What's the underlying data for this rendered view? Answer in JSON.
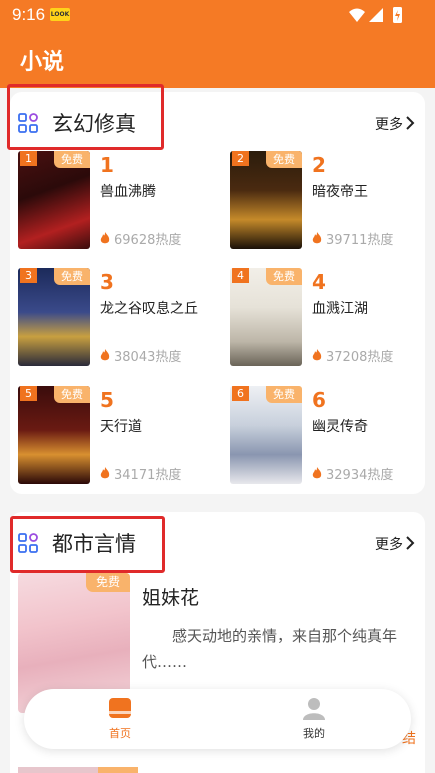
{
  "status": {
    "time": "9:16",
    "badge": "LOOK"
  },
  "header": {
    "title": "小说"
  },
  "sections": [
    {
      "title": "玄幻修真",
      "more": "更多",
      "books": [
        {
          "rank": "1",
          "name": "兽血沸腾",
          "heat": "69628热度",
          "free": "免费"
        },
        {
          "rank": "2",
          "name": "暗夜帝王",
          "heat": "39711热度",
          "free": "免费"
        },
        {
          "rank": "3",
          "name": "龙之谷叹息之丘",
          "heat": "38043热度",
          "free": "免费"
        },
        {
          "rank": "4",
          "name": "血溅江湖",
          "heat": "37208热度",
          "free": "免费"
        },
        {
          "rank": "5",
          "name": "天行道",
          "heat": "34171热度",
          "free": "免费"
        },
        {
          "rank": "6",
          "name": "幽灵传奇",
          "heat": "32934热度",
          "free": "免费"
        }
      ]
    },
    {
      "title": "都市言情",
      "more": "更多",
      "featured": {
        "free": "免费",
        "title": "姐妹花",
        "desc": "感天动地的亲情，来自那个纯真年代……"
      }
    }
  ],
  "nav": {
    "home": "首页",
    "mine": "我的"
  },
  "peek": "结",
  "colors": {
    "brand": "#f57a25",
    "accent": "#f0731f",
    "free_tag": "#f9b36b",
    "highlight": "#e02a2a"
  }
}
